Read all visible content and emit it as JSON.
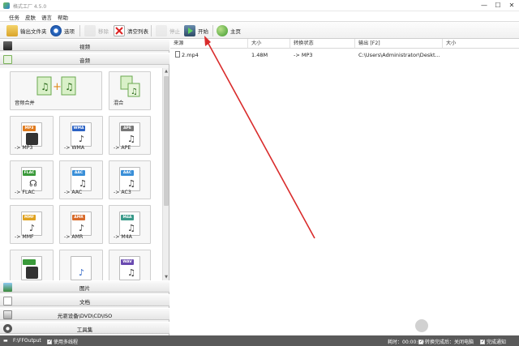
{
  "window": {
    "title": "格式工厂 4.5.0",
    "minimize": "—",
    "maximize": "☐",
    "close": "✕"
  },
  "menu": [
    "任务",
    "皮肤",
    "语言",
    "帮助"
  ],
  "toolbar": {
    "output_folder": "输出文件夹",
    "options": "选项",
    "remove": "移除",
    "clear_list": "清空列表",
    "stop": "停止",
    "start": "开始",
    "home": "主页"
  },
  "sidebar": {
    "video": "视频",
    "audio": "音频",
    "image": "图片",
    "document": "文档",
    "disc": "光驱设备\\DVD\\CD\\ISO",
    "toolbox": "工具集"
  },
  "tiles": [
    {
      "label": "音频合并"
    },
    {
      "label": "混合"
    },
    {
      "label": "-> MP3",
      "badge": "MP3",
      "badge_color": "#e07b1f"
    },
    {
      "label": "-> WMA",
      "badge": "WMA",
      "badge_color": "#2b62c4"
    },
    {
      "label": "-> APE",
      "badge": "APE",
      "badge_color": "#777777"
    },
    {
      "label": "-> FLAC",
      "badge": "FLAC",
      "badge_color": "#3a9a3a"
    },
    {
      "label": "-> AAC",
      "badge": "AAC",
      "badge_color": "#3a8fd8"
    },
    {
      "label": "-> AC3",
      "badge": "AAC",
      "badge_color": "#3a8fd8"
    },
    {
      "label": "-> MMF",
      "badge": "MMF",
      "badge_color": "#e0a21f"
    },
    {
      "label": "-> AMR",
      "badge": "AMR",
      "badge_color": "#d86a2a"
    },
    {
      "label": "-> M4A",
      "badge": "M4A",
      "badge_color": "#3a9a8a"
    },
    {
      "label": "",
      "badge": "",
      "badge_color": "#3a9a3a"
    },
    {
      "label": "",
      "badge": "",
      "badge_color": "#8a5ab0"
    },
    {
      "label": "",
      "badge": "WAV",
      "badge_color": "#6a4ab0"
    }
  ],
  "table": {
    "columns": [
      "来源",
      "大小",
      "转换状态",
      "输出 [F2]",
      "大小"
    ],
    "rows": [
      {
        "source": "2.mp4",
        "size": "1.48M",
        "status": "-> MP3",
        "output": "C:\\Users\\Administrator\\Deskt...",
        "out_size": ""
      }
    ]
  },
  "status": {
    "output_path": "F:\\FFOutput",
    "multithread": "使用多线程",
    "elapsed": "耗时：00:00:00",
    "after_convert": "转换完成后：关闭电脑",
    "notify": "完成通知"
  },
  "watermark": "头条@问答",
  "colors": {
    "arrow": "#d92b2b",
    "statusbar": "#5a5a5a"
  }
}
